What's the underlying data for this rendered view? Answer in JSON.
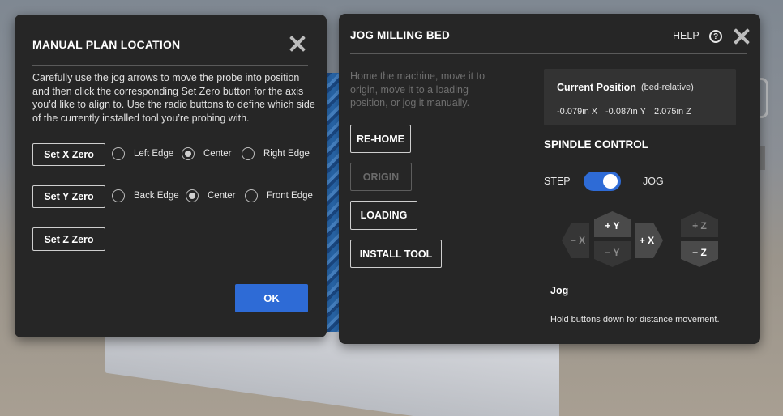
{
  "manual_plan": {
    "title": "MANUAL PLAN LOCATION",
    "description": "Carefully use the jog arrows to move the probe into position and then click the corresponding Set Zero button for the axis you’d like to align to. Use the radio buttons to define which side of the currently installed tool you’re probing with.",
    "rows": [
      {
        "button": "Set X Zero",
        "options": [
          {
            "label": "Left Edge",
            "checked": false
          },
          {
            "label": "Center",
            "checked": true
          },
          {
            "label": "Right Edge",
            "checked": false
          }
        ]
      },
      {
        "button": "Set Y Zero",
        "options": [
          {
            "label": "Back Edge",
            "checked": false
          },
          {
            "label": "Center",
            "checked": true
          },
          {
            "label": "Front Edge",
            "checked": false
          }
        ]
      },
      {
        "button": "Set Z Zero",
        "options": []
      }
    ],
    "ok_label": "OK"
  },
  "jog_bed": {
    "title": "JOG MILLING BED",
    "help_label": "HELP",
    "help_icon": "?",
    "description": "Home the machine, move it to origin, move it to a loading position, or jog it manually.",
    "buttons": [
      {
        "label": "RE-HOME",
        "disabled": false
      },
      {
        "label": "ORIGIN",
        "disabled": true
      },
      {
        "label": "LOADING",
        "disabled": false
      },
      {
        "label": "INSTALL TOOL",
        "disabled": false
      }
    ],
    "current_position": {
      "title": "Current Position",
      "qualifier": "(bed-relative)",
      "x": "-0.079in X",
      "y": "-0.087in Y",
      "z": "2.075in Z"
    },
    "spindle_control": {
      "title": "SPINDLE CONTROL",
      "left_label": "STEP",
      "right_label": "JOG",
      "jog_mode_on": true
    },
    "jog_pad": {
      "minus_x": "− X",
      "plus_y": "+ Y",
      "minus_y": "− Y",
      "plus_x": "+ X",
      "plus_z": "+ Z",
      "minus_z": "− Z"
    },
    "jog_section": {
      "title": "Jog",
      "hint": "Hold buttons down for distance movement."
    }
  },
  "colors": {
    "panel_bg": "#262626",
    "accent_blue": "#2e6bd6",
    "jog_button_active": "#4a4a4a",
    "jog_button_dim": "#363636"
  }
}
